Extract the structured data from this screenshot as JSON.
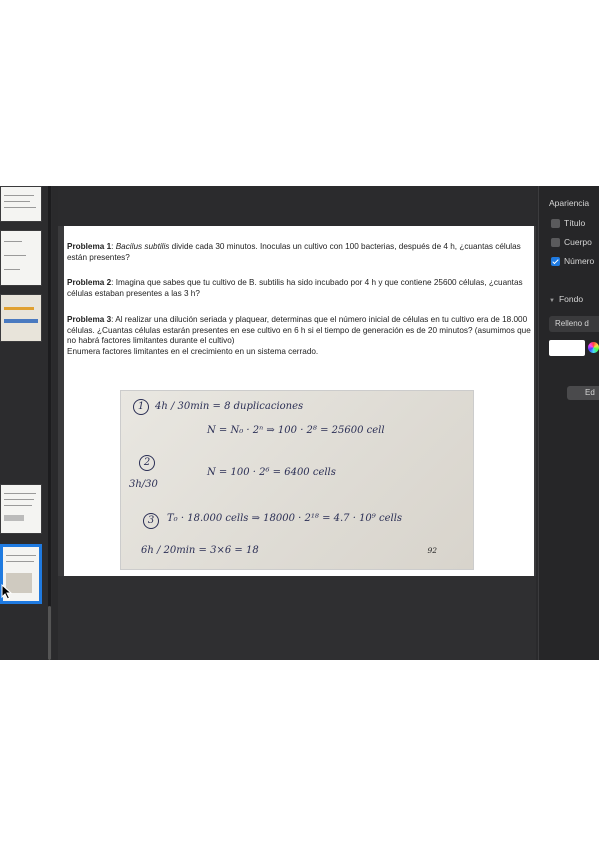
{
  "problems": [
    {
      "label": "Problema 1",
      "text_italic": "Bacilus subtilis",
      "text": " divide cada 30 minutos. Inoculas un cultivo con 100 bacterias, después de 4 h, ¿cuantas células están presentes?"
    },
    {
      "label": "Problema 2",
      "text": ": Imagina que sabes que tu cultivo de B. subtilis ha sido incubado por 4 h y que contiene 25600 células, ¿cuantas células estaban presentes a las 3 h?"
    },
    {
      "label": "Problema 3",
      "text": ": Al realizar una dilución seriada y plaquear, determinas que el número inicial de células en tu cultivo era de 18.000 células. ¿Cuantas células estarán presentes en ese cultivo en 6 h si el tiempo de generación es de 20 minutos? (asumimos que no habrá factores limitantes durante el cultivo)"
    }
  ],
  "extra_line": "Enumera factores limitantes en el crecimiento en un sistema cerrado.",
  "handwriting": {
    "n1": "1",
    "line1a": "4h / 30min = 8 duplicaciones",
    "line1b": "N = N₀ · 2ⁿ ⇒ 100 · 2⁸ = 25600 cell",
    "n2": "2",
    "frac2": "3h/30",
    "line2": "N = 100 · 2⁶ = 6400 cells",
    "n3": "3",
    "line3": "T₀ · 18.000 cells ⇒ 18000 · 2¹⁸ = 4.7 · 10⁹ cells",
    "line4": "6h / 20min = 3×6 = 18"
  },
  "page_number": "92",
  "inspector": {
    "title": "Apariencia",
    "options": [
      {
        "label": "Título",
        "checked": false
      },
      {
        "label": "Cuerpo",
        "checked": false
      },
      {
        "label": "Número",
        "checked": true
      }
    ],
    "section": "Fondo",
    "fill_select": "Relleno d",
    "edit_button": "Ed",
    "swatch_color": "#ffffff",
    "accent_color": "#1f7ae0"
  }
}
